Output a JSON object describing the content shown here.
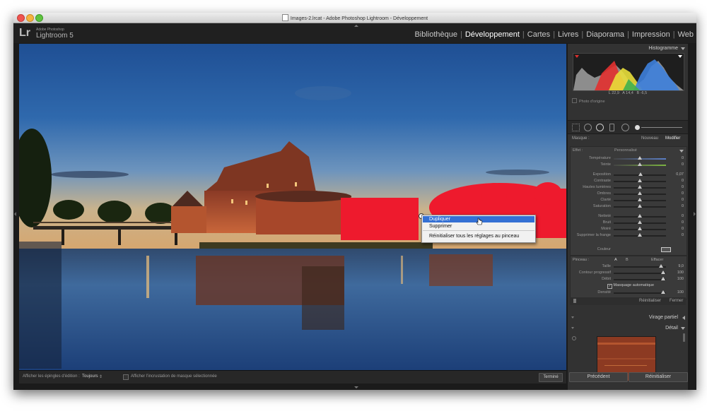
{
  "window": {
    "title": "Images-2.lrcat - Adobe Photoshop Lightroom - Développement"
  },
  "app": {
    "logo": "Lr",
    "vendor": "Adobe Photoshop",
    "name": "Lightroom 5"
  },
  "modules": [
    {
      "label": "Bibliothèque",
      "active": false
    },
    {
      "label": "Développement",
      "active": true
    },
    {
      "label": "Cartes",
      "active": false
    },
    {
      "label": "Livres",
      "active": false
    },
    {
      "label": "Diaporama",
      "active": false
    },
    {
      "label": "Impression",
      "active": false
    },
    {
      "label": "Web",
      "active": false
    }
  ],
  "context_menu": {
    "items": [
      "Dupliquer",
      "Supprimer",
      "Réinitialiser tous les réglages au pinceau"
    ],
    "highlighted_index": 0
  },
  "toolbar": {
    "pins_label": "Afficher les épingles d'édition :",
    "pins_value": "Toujours",
    "overlay_label": "Afficher l'incrustation de masque sélectionnée",
    "done_button": "Terminé"
  },
  "histogram": {
    "title": "Histogramme",
    "readout": {
      "L_label": "L",
      "L": "22,9",
      "A_label": "A",
      "A": "14,4",
      "B_label": "B",
      "B": "-6,5"
    },
    "original_photo": "Photo d'origine"
  },
  "mask": {
    "label": "Masque :",
    "new": "Nouveau",
    "edit": "Modifier"
  },
  "effect": {
    "label": "Effet :",
    "preset": "Personnalisé",
    "sliders": [
      {
        "name": "Température",
        "value": "0",
        "pos": 0.5,
        "color": "#5b7fc6"
      },
      {
        "name": "Teinte",
        "value": "0",
        "pos": 0.5,
        "color": "#7cb342"
      },
      {
        "name": "Exposition",
        "value": "0,07",
        "pos": 0.52,
        "color": ""
      },
      {
        "name": "Contraste",
        "value": "0",
        "pos": 0.5,
        "color": ""
      },
      {
        "name": "Hautes lumières",
        "value": "0",
        "pos": 0.5,
        "color": ""
      },
      {
        "name": "Ombres",
        "value": "0",
        "pos": 0.5,
        "color": ""
      },
      {
        "name": "Clarté",
        "value": "0",
        "pos": 0.5,
        "color": ""
      },
      {
        "name": "Saturation",
        "value": "0",
        "pos": 0.5,
        "color": ""
      },
      {
        "name": "Netteté",
        "value": "0",
        "pos": 0.5,
        "color": ""
      },
      {
        "name": "Bruit",
        "value": "0",
        "pos": 0.5,
        "color": ""
      },
      {
        "name": "Moiré",
        "value": "0",
        "pos": 0.5,
        "color": ""
      },
      {
        "name": "Supprimer la frange",
        "value": "0",
        "pos": 0.5,
        "color": ""
      }
    ],
    "color_label": "Couleur"
  },
  "brush": {
    "label": "Pinceau :",
    "a": "A",
    "b": "B",
    "erase": "Effacer",
    "size_label": "Taille",
    "size": "9,0",
    "size_pos": 0.9,
    "feather_label": "Contour progressif",
    "feather": "100",
    "feather_pos": 0.95,
    "flow_label": "Débit",
    "flow": "100",
    "flow_pos": 0.95,
    "auto_mask": "Masquage automatique",
    "density_label": "Densité",
    "density": "100",
    "density_pos": 0.95
  },
  "panel_footer": {
    "reset": "Réinitialiser",
    "close": "Fermer"
  },
  "sections": {
    "split_toning": "Virage partiel",
    "detail": "Détail"
  },
  "nav": {
    "previous": "Précédent",
    "reset": "Réinitialiser"
  }
}
